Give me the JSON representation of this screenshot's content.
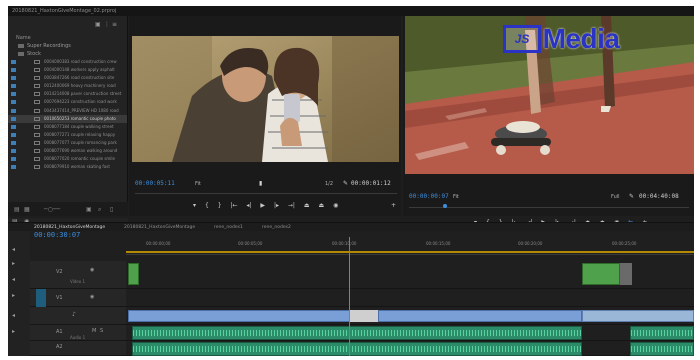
{
  "window_title": "20180821_HaxtonGiveMontage_02.prproj",
  "project": {
    "header_label": "Name",
    "bins": [
      {
        "label": "Super Recordings"
      },
      {
        "label": "Stock"
      }
    ],
    "clips": [
      {
        "label": "0004000383 road construction crew"
      },
      {
        "label": "0004000148 workers apply asphalt"
      },
      {
        "label": "0003847266 road construction site"
      },
      {
        "label": "0012400069 heavy machinery road"
      },
      {
        "label": "0014214008 paver construction street"
      },
      {
        "label": "0007694223 construction road work"
      },
      {
        "label": "0043437414_PREVIEW HD 1080 road"
      },
      {
        "label": "0010650253 romantic couple photo",
        "selected": true
      },
      {
        "label": "0008077184 couple walking street"
      },
      {
        "label": "0008077271 couple relaxing happy"
      },
      {
        "label": "0008077077 couple romancing park"
      },
      {
        "label": "0008077690 woman walking around"
      },
      {
        "label": "0008077020 romantic couple smile"
      },
      {
        "label": "0008079910 woman skating fast"
      }
    ]
  },
  "source_monitor": {
    "timecode_current": "00:00:05:11",
    "fit_label": "Fit",
    "resolution_label": "1/2",
    "timecode_duration": "00:00:01:12"
  },
  "program_monitor": {
    "timecode_current": "00:00:00:07",
    "fit_label": "Fit",
    "resolution_label": "Full",
    "timecode_duration": "00:04:40:08",
    "watermark_prefix": "JS",
    "watermark_text": "Media"
  },
  "sequence": {
    "tabs": [
      "20180821_HaxtonGiveMontage",
      "20180821_HaxtonGiveMontage",
      "rene_nodes1",
      "rene_nodes2"
    ],
    "timecode": "00:00:30:07",
    "ruler": [
      "00:00:00;00",
      "00:00:05;00",
      "00:00:10;00",
      "00:00:15;00",
      "00:00:20;00",
      "00:00:25;00"
    ],
    "tracks": {
      "v2": "V2",
      "v1": "V1",
      "a1": "A1",
      "a2": "A2",
      "video_label": "Video 1",
      "audio_label": "Audio 1"
    }
  },
  "colors": {
    "accent": "#3d8fe0",
    "video_clip": "#4fa24b",
    "audio_clip": "#2c8c6a",
    "adjust_clip": "#7a9fd6",
    "watermark_blue": "#2a33c4"
  }
}
